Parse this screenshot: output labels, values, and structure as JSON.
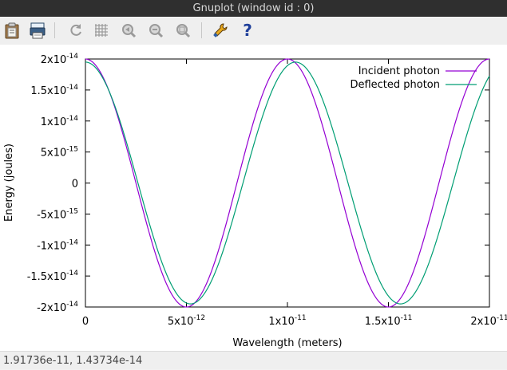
{
  "window": {
    "title": "Gnuplot (window id : 0)"
  },
  "toolbar": {
    "buttons": [
      {
        "name": "copy-clipboard",
        "icon": "clipboard-icon"
      },
      {
        "name": "print",
        "icon": "print-icon"
      },
      {
        "name": "replot",
        "icon": "replot-icon"
      },
      {
        "name": "grid",
        "icon": "grid-icon"
      },
      {
        "name": "previous-zoom",
        "icon": "zoom-previous-icon"
      },
      {
        "name": "next-zoom",
        "icon": "zoom-next-icon"
      },
      {
        "name": "autoscale",
        "icon": "autoscale-icon"
      },
      {
        "name": "settings",
        "icon": "wrench-icon"
      },
      {
        "name": "help",
        "icon": "help-icon",
        "label": "?"
      }
    ]
  },
  "status": {
    "coords": "1.91736e-11, 1.43734e-14"
  },
  "chart_data": {
    "type": "line",
    "title": "",
    "xlabel": "Wavelength (meters)",
    "ylabel": "Energy (joules)",
    "xlim": [
      0,
      2e-11
    ],
    "ylim": [
      -2e-14,
      2e-14
    ],
    "x_ticks": [
      {
        "value": 0,
        "base": "0",
        "exp": ""
      },
      {
        "value": 5e-12,
        "base": "5x10",
        "exp": "-12"
      },
      {
        "value": 1e-11,
        "base": "1x10",
        "exp": "-11"
      },
      {
        "value": 1.5e-11,
        "base": "1.5x10",
        "exp": "-11"
      },
      {
        "value": 2e-11,
        "base": "2x10",
        "exp": "-11"
      }
    ],
    "y_ticks": [
      {
        "value": 2e-14,
        "base": "2x10",
        "exp": "-14"
      },
      {
        "value": 1.5e-14,
        "base": "1.5x10",
        "exp": "-14"
      },
      {
        "value": 1e-14,
        "base": "1x10",
        "exp": "-14"
      },
      {
        "value": 5e-15,
        "base": "5x10",
        "exp": "-15"
      },
      {
        "value": 0,
        "base": "0",
        "exp": ""
      },
      {
        "value": -5e-15,
        "base": "-5x10",
        "exp": "-15"
      },
      {
        "value": -1e-14,
        "base": "-1x10",
        "exp": "-14"
      },
      {
        "value": -1.5e-14,
        "base": "-1.5x10",
        "exp": "-14"
      },
      {
        "value": -2e-14,
        "base": "-2x10",
        "exp": "-14"
      }
    ],
    "legend_position": "top-right",
    "grid": false,
    "series": [
      {
        "name": "Incident photon",
        "color": "#9400d3",
        "amplitude": 2e-14,
        "period": 1e-11
      },
      {
        "name": "Deflected photon",
        "color": "#009e73",
        "amplitude": 1.95e-14,
        "period": 1.04e-11
      }
    ]
  }
}
